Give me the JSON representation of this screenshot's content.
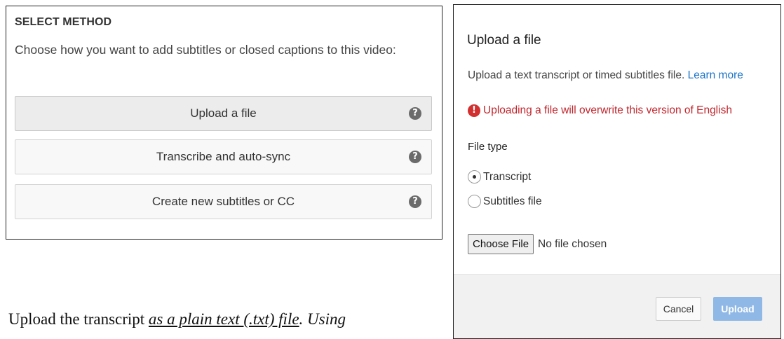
{
  "select_method": {
    "title": "SELECT METHOD",
    "description": "Choose how you want to add subtitles or closed captions to this video:",
    "options": [
      {
        "label": "Upload a file",
        "help_icon": "question-circle-icon"
      },
      {
        "label": "Transcribe and auto-sync",
        "help_icon": "question-circle-icon"
      },
      {
        "label": "Create new subtitles or CC",
        "help_icon": "question-circle-icon"
      }
    ],
    "help_glyph": "?"
  },
  "caption": {
    "prefix": "Upload the transcript ",
    "underlined": "as a plain text (.txt) file",
    "suffix": ". Using"
  },
  "upload_dialog": {
    "title": "Upload a file",
    "description": "Upload a text transcript or timed subtitles file.",
    "learn_more": "Learn more",
    "warning_icon": "exclamation-circle-icon",
    "warning_glyph": "!",
    "warning": "Uploading a file will overwrite this version of English",
    "file_type_label": "File type",
    "file_types": [
      {
        "label": "Transcript",
        "checked": true
      },
      {
        "label": "Subtitles file",
        "checked": false
      }
    ],
    "choose_file_label": "Choose File",
    "no_file_text": "No file chosen",
    "cancel_label": "Cancel",
    "upload_label": "Upload"
  },
  "colors": {
    "warning": "#c0262d",
    "link": "#1a73c8",
    "upload_button_disabled": "#8fb8e6"
  }
}
